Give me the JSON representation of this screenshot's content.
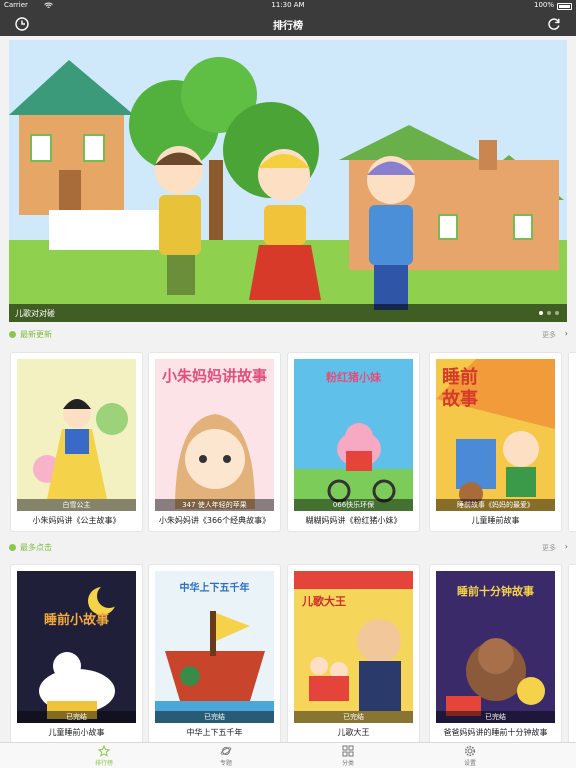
{
  "status_bar": {
    "carrier": "Carrier",
    "time": "11:30 AM",
    "battery": "100%"
  },
  "nav": {
    "title": "排行榜"
  },
  "banner": {
    "caption": "儿歌对对碰"
  },
  "sections": [
    {
      "title": "最新更新",
      "more": "更多",
      "items": [
        {
          "cover_text": "白雪公主",
          "title": "小朱妈妈讲《公主故事》",
          "cover_heading": ""
        },
        {
          "cover_text": "347 使人年轻的苹果",
          "title": "小朱妈妈讲《366个经典故事》",
          "cover_heading": "小朱妈妈讲故事"
        },
        {
          "cover_text": "066快乐环保",
          "title": "糊糊妈妈讲《粉红猪小妹》",
          "cover_heading": "粉红猪小妹"
        },
        {
          "cover_text": "睡前故事《妈妈的最爱》",
          "title": "儿童睡前故事",
          "cover_heading": "睡前故事"
        }
      ]
    },
    {
      "title": "最多点击",
      "more": "更多",
      "items": [
        {
          "cover_text": "已完结",
          "title": "儿童睡前小故事",
          "cover_heading": "睡前小故事"
        },
        {
          "cover_text": "已完结",
          "title": "中华上下五千年",
          "cover_heading": "中华上下五千年"
        },
        {
          "cover_text": "已完结",
          "title": "儿歌大王",
          "cover_heading": "儿歌大王"
        },
        {
          "cover_text": "已完结",
          "title": "爸爸妈妈讲的睡前十分钟故事",
          "cover_heading": "睡前十分钟故事"
        }
      ]
    }
  ],
  "tabs": [
    {
      "label": "排行榜",
      "icon": "star-icon",
      "active": true
    },
    {
      "label": "专题",
      "icon": "planet-icon",
      "active": false
    },
    {
      "label": "分类",
      "icon": "grid-icon",
      "active": false
    },
    {
      "label": "设置",
      "icon": "gear-icon",
      "active": false
    }
  ],
  "colors": {
    "accent": "#8ac84a",
    "navbar": "#3b3b3b"
  }
}
